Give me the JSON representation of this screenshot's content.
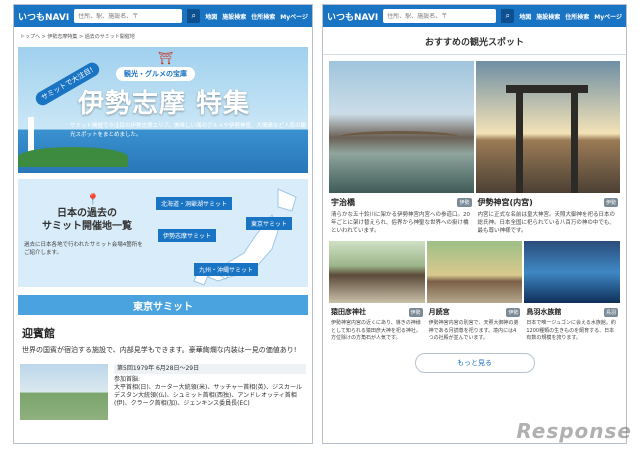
{
  "header": {
    "logo": "いつもNAVI",
    "search_placeholder": "住所、駅、施設名、〒",
    "search_icon": "magnifier",
    "nav": [
      "地図",
      "施設検索",
      "住所検索",
      "Myページ"
    ]
  },
  "left": {
    "breadcrumb": "トップへ > 伊勢志摩特集 > 過去のサミット開催地",
    "hero": {
      "ribbon": "サミットで大注目!",
      "category": "観光・グルメの宝庫",
      "title": "伊勢志摩 特集",
      "desc": "サミット開催で今注目の伊勢志摩エリア。美味しい海のグルメや伊勢神宮、大鳴島など人気の観光スポットをまとめました。"
    },
    "map": {
      "title": "日本の過去の\nサミット開催地一覧",
      "sub": "過去に日本各地で行われたサミット会場4箇所をご紹介します。",
      "tags": [
        "北海道・洞爺湖サミット",
        "伊勢志摩サミット",
        "東京サミット",
        "九州・沖縄サミット"
      ]
    },
    "section": "東京サミット",
    "venue": "迎賓館",
    "venue_desc": "世界の国賓が宿泊する施設で、内部見学もできます。豪華絢爛な内装は一見の価値あり!",
    "event": "第5回1979年 6月28日～29日",
    "participants_label": "参加首脳:",
    "participants": "大平首相(日)、カーター大統領(米)、サッチャー首相(英)、ジスカールデスタン大統領(仏)、シュミット首相(西独)、アンドレオッティ首相(伊)、クラーク首相(加)、ジェンキンス委員長(EC)"
  },
  "right": {
    "title": "おすすめの観光スポット",
    "spots_top": [
      {
        "name": "宇治橋",
        "pref": "伊勢",
        "desc": "清らかな五十鈴川に架かる伊勢神宮内宮への参道口。20年ごとに架け替えられ、俗界から神聖な世界への掛け橋といわれています。"
      },
      {
        "name": "伊勢神宮(内宮)",
        "pref": "伊勢",
        "desc": "内宮に正式な名前は皇大神宮。天照大御神を祀る日本の総氏神。日本全国に祀られている八百万の神の中でも、最も尊い神様です。"
      }
    ],
    "spots_bottom": [
      {
        "name": "猿田彦神社",
        "pref": "伊勢",
        "desc": "伊勢神宮内宮の近くにあり、導きの神様として知られる猿田彦大神を祀る神社。方位除けの方角石が人気です。"
      },
      {
        "name": "月読宮",
        "pref": "伊勢",
        "desc": "伊勢神宮内宮の別宮で、天照大御神の弟神である月読尊を祀ります。境内には4つの社殿が並んでいます。"
      },
      {
        "name": "鳥羽水族館",
        "pref": "鳥羽",
        "desc": "日本で唯一ジュゴンに会える水族館。約1200種類の生きものを飼育する、日本有数の規模を誇ります。"
      }
    ],
    "more": "もっと見る"
  },
  "watermark": "Response"
}
